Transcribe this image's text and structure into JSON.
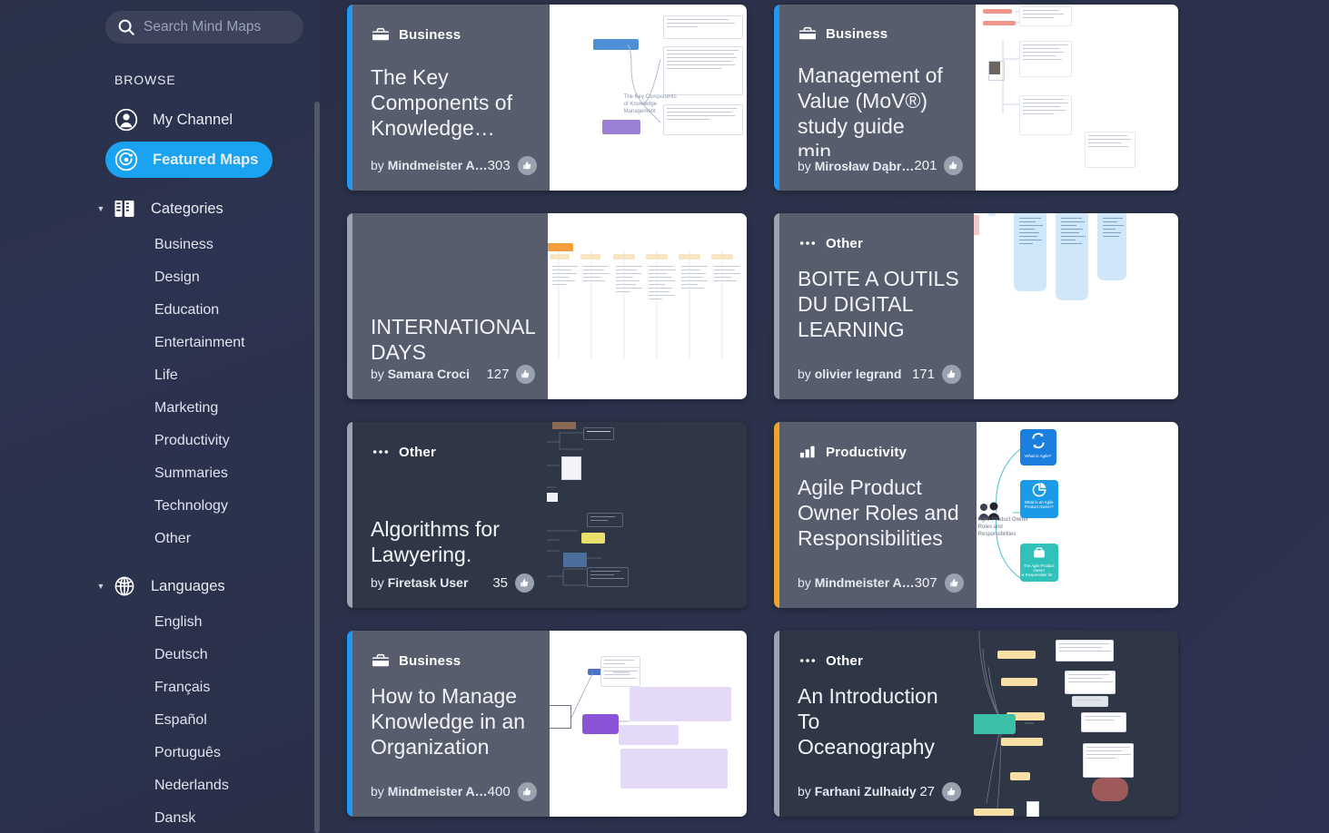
{
  "search": {
    "placeholder": "Search Mind Maps",
    "value": "",
    "icon": "search-icon"
  },
  "sidebar": {
    "section_label": "BROWSE",
    "nav": [
      {
        "label": "My Channel",
        "icon": "user-avatar-icon",
        "active": false
      },
      {
        "label": "Featured Maps",
        "icon": "featured-maps-icon",
        "active": true
      }
    ],
    "groups": [
      {
        "label": "Categories",
        "icon": "categories-icon",
        "expanded": true,
        "items": [
          "Business",
          "Design",
          "Education",
          "Entertainment",
          "Life",
          "Marketing",
          "Productivity",
          "Summaries",
          "Technology",
          "Other"
        ]
      },
      {
        "label": "Languages",
        "icon": "globe-icon",
        "expanded": true,
        "items": [
          "English",
          "Deutsch",
          "Français",
          "Español",
          "Português",
          "Nederlands",
          "Dansk"
        ]
      }
    ]
  },
  "colors": {
    "accent_business": "#2196f3",
    "accent_productivity": "#f0a32a",
    "accent_other": "#9aa3b0",
    "accent_none": "#9aa3b0",
    "active_nav": "#19a3f0",
    "card_info_bg": "#575d6c",
    "card_info_bg_dark": "#2f3646"
  },
  "cards": [
    {
      "category": "Business",
      "category_icon": "briefcase-icon",
      "title": "The Key Components of Knowledge…",
      "author_prefix": "by",
      "author": "Mindmeister A…",
      "likes": "303",
      "like_icon": "thumbs-up-icon",
      "accent": "#2196f3",
      "thumb_style": "light"
    },
    {
      "category": "Business",
      "category_icon": "briefcase-icon",
      "title": "Management of Value (MoV®) study guide min…",
      "author_prefix": "by",
      "author": "Mirosław Dąbr…",
      "likes": "201",
      "like_icon": "thumbs-up-icon",
      "accent": "#2196f3",
      "thumb_style": "light"
    },
    {
      "category": "",
      "category_icon": "",
      "title": "INTERNATIONAL DAYS",
      "author_prefix": "by",
      "author": "Samara Croci",
      "likes": "127",
      "like_icon": "thumbs-up-icon",
      "accent": "#9aa3b0",
      "thumb_style": "light"
    },
    {
      "category": "Other",
      "category_icon": "dots-icon",
      "title": "BOITE A OUTILS DU DIGITAL LEARNING",
      "author_prefix": "by",
      "author": "olivier legrand",
      "likes": "171",
      "like_icon": "thumbs-up-icon",
      "accent": "#9aa3b0",
      "thumb_style": "light"
    },
    {
      "category": "Other",
      "category_icon": "dots-icon",
      "title": "Algorithms for Lawyering.",
      "author_prefix": "by",
      "author": "Firetask User",
      "likes": "35",
      "like_icon": "thumbs-up-icon",
      "accent": "#9aa3b0",
      "thumb_style": "dark"
    },
    {
      "category": "Productivity",
      "category_icon": "bar-chart-icon",
      "title": "Agile Product Owner Roles and Responsibilities",
      "author_prefix": "by",
      "author": "Mindmeister A…",
      "likes": "307",
      "like_icon": "thumbs-up-icon",
      "accent": "#f0a32a",
      "thumb_style": "light"
    },
    {
      "category": "Business",
      "category_icon": "briefcase-icon",
      "title": "How to Manage Knowledge in an Organization",
      "author_prefix": "by",
      "author": "Mindmeister A…",
      "likes": "400",
      "like_icon": "thumbs-up-icon",
      "accent": "#2196f3",
      "thumb_style": "light"
    },
    {
      "category": "Other",
      "category_icon": "dots-icon",
      "title": "An Introduction To Oceanography",
      "author_prefix": "by",
      "author": "Farhani Zulhaidy",
      "likes": "27",
      "like_icon": "thumbs-up-icon",
      "accent": "#9aa3b0",
      "thumb_style": "dark"
    }
  ]
}
